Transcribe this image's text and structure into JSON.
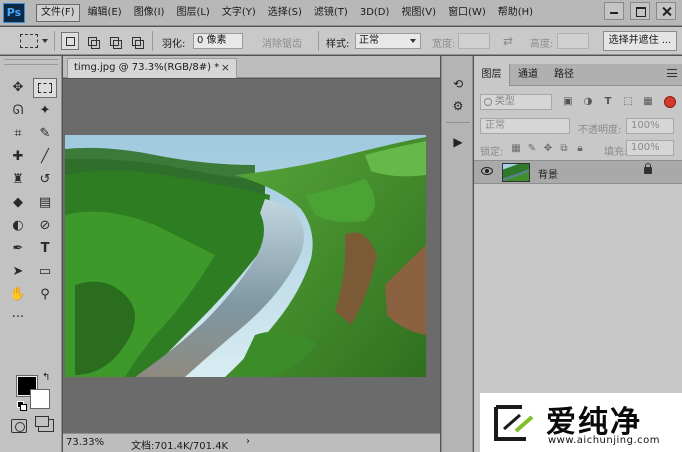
{
  "app": {
    "logo_text": "Ps"
  },
  "menu": {
    "items": [
      {
        "label": "文件(F)",
        "active": true
      },
      {
        "label": "编辑(E)"
      },
      {
        "label": "图像(I)"
      },
      {
        "label": "图层(L)"
      },
      {
        "label": "文字(Y)"
      },
      {
        "label": "选择(S)"
      },
      {
        "label": "滤镜(T)"
      },
      {
        "label": "3D(D)"
      },
      {
        "label": "视图(V)"
      },
      {
        "label": "窗口(W)"
      },
      {
        "label": "帮助(H)"
      }
    ]
  },
  "options": {
    "feather_label": "羽化:",
    "feather_value": "0 像素",
    "antialias_label": "消除锯齿",
    "style_label": "样式:",
    "style_value": "正常",
    "width_label": "宽度:",
    "height_label": "高度:",
    "refine_button": "选择并遮住 ..."
  },
  "document": {
    "tab_title": "timg.jpg @ 73.3%(RGB/8#) *",
    "close_glyph": "×",
    "zoom": "73.33%",
    "doc_size": "文档:701.4K/701.4K",
    "status_arrow": "›"
  },
  "layers_panel": {
    "tabs": [
      "图层",
      "通道",
      "路径"
    ],
    "filter_placeholder": "类型",
    "blend_mode": "正常",
    "opacity_label": "不透明度:",
    "opacity_value": "100%",
    "lock_label": "锁定:",
    "fill_label": "填充:",
    "fill_value": "100%",
    "layers": [
      {
        "name": "背景",
        "visible": true,
        "locked": true
      }
    ]
  },
  "watermark": {
    "title": "爱纯净",
    "url": "www.aichunjing.com"
  },
  "colors": {
    "foreground": "#000000",
    "background": "#ffffff",
    "ui_panel": "#c8c8c8",
    "canvas_bg": "#6b6b6b"
  },
  "tools": {
    "icons": [
      "move-icon",
      "marquee-icon",
      "lasso-icon",
      "magic-wand-icon",
      "crop-icon",
      "eyedropper-icon",
      "healing-brush-icon",
      "brush-icon",
      "clone-stamp-icon",
      "history-brush-icon",
      "eraser-icon",
      "gradient-icon",
      "blur-icon",
      "dodge-icon",
      "pen-icon",
      "type-icon",
      "path-select-icon",
      "rectangle-icon",
      "hand-icon",
      "zoom-icon",
      "more-tools-icon"
    ]
  }
}
